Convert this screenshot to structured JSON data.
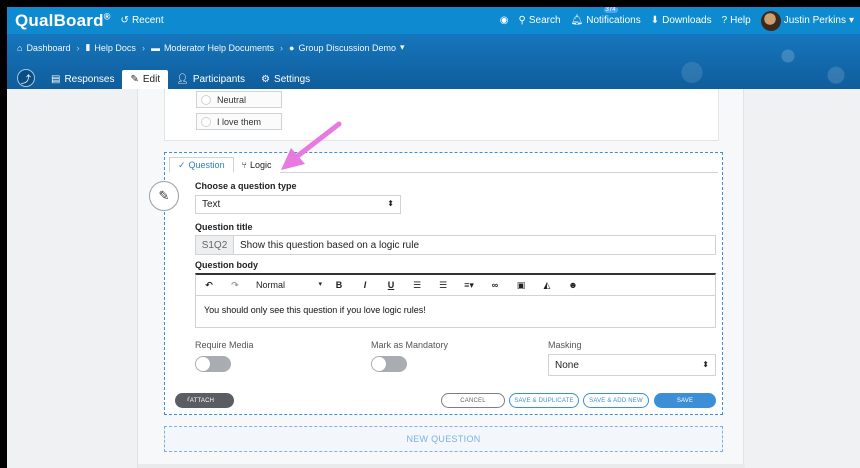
{
  "topbar": {
    "brand": "QualBoard",
    "brand_mark": "®",
    "recent": "Recent",
    "search": "Search",
    "notifications": "Notifications",
    "notif_count": "374",
    "downloads": "Downloads",
    "help": "Help",
    "user": "Justin Perkins"
  },
  "breadcrumb": {
    "items": [
      "Dashboard",
      "Help Docs",
      "Moderator Help Documents",
      "Group Discussion Demo"
    ]
  },
  "tabs": [
    "Responses",
    "Edit",
    "Participants",
    "Settings"
  ],
  "previous_options": [
    "Neutral",
    "I love them"
  ],
  "question": {
    "tab_question": "Question",
    "tab_logic": "Logic",
    "type_label": "Choose a question type",
    "type_value": "Text",
    "title_label": "Question title",
    "title_code": "S1Q2",
    "title_value": "Show this question based on a logic rule",
    "body_label": "Question body",
    "format_value": "Normal",
    "body_text": "You should only see this question if you love logic rules!",
    "require_media_label": "Require Media",
    "mandatory_label": "Mark as Mandatory",
    "masking_label": "Masking",
    "masking_value": "None",
    "attach_label": "ATTACH",
    "cancel_label": "CANCEL",
    "save_duplicate_label": "SAVE & DUPLICATE",
    "save_add_label": "SAVE & ADD NEW",
    "save_label": "SAVE"
  },
  "new_question_label": "NEW QUESTION",
  "colors": {
    "topbar": "#0e8ad0",
    "banner": "#1676bd",
    "accent": "#3c8fd6",
    "annotation_arrow": "#e879e0"
  }
}
